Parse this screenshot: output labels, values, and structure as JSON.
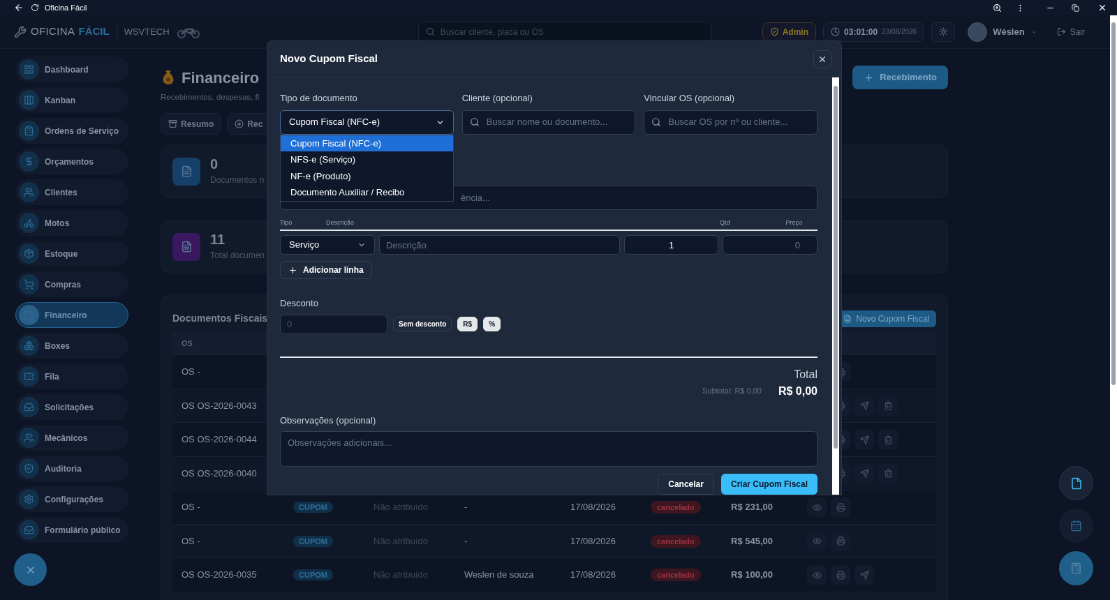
{
  "browser": {
    "title": "Oficina Fácil"
  },
  "header": {
    "brand": "OFICINA",
    "brand_accent": "FÁCIL",
    "company": "WSVTECH",
    "search": {
      "placeholder": "Buscar cliente, placa ou OS"
    },
    "role": "Admin",
    "time": "03:01:00",
    "date": "23/08/2026",
    "user": "Wéslen",
    "logout": "Sair"
  },
  "sidebar": {
    "items": [
      {
        "label": "Dashboard",
        "selected": false
      },
      {
        "label": "Kanban",
        "selected": false
      },
      {
        "label": "Ordens de Serviço",
        "selected": false
      },
      {
        "label": "Orçamentos",
        "selected": false
      },
      {
        "label": "Clientes",
        "selected": false
      },
      {
        "label": "Motos",
        "selected": false
      },
      {
        "label": "Estoque",
        "selected": false
      },
      {
        "label": "Compras",
        "selected": false
      },
      {
        "label": "Financeiro",
        "selected": true
      },
      {
        "label": "Boxes",
        "selected": false
      },
      {
        "label": "Fila",
        "selected": false
      },
      {
        "label": "Solicitações",
        "selected": false
      },
      {
        "label": "Mecânicos",
        "selected": false
      },
      {
        "label": "Auditoria",
        "selected": false
      },
      {
        "label": "Configurações",
        "selected": false
      },
      {
        "label": "Formulário público",
        "selected": false
      }
    ]
  },
  "page": {
    "title": "Financeiro",
    "subtitle": "Recebimentos, despesas, fl",
    "primary_button": "Recebimento",
    "tabs": [
      {
        "label": "Resumo"
      },
      {
        "label": "Rec"
      }
    ],
    "stats": [
      {
        "value": "0",
        "label": "Documentos n",
        "color": "#15406a"
      },
      {
        "value": "11",
        "label": "Total documen",
        "color": "#3a1860"
      }
    ],
    "fiscal": {
      "title": "Documentos Fiscais",
      "button": "Novo Cupom Fiscal",
      "columns": [
        "OS"
      ],
      "rows": [
        {
          "os": "OS -",
          "sendable": false,
          "deletable": false
        },
        {
          "os": "OS OS-2026-0043",
          "sendable": true,
          "deletable": true
        },
        {
          "os": "OS OS-2026-0044",
          "sendable": true,
          "deletable": true
        },
        {
          "os": "OS OS-2026-0040",
          "sendable": true,
          "deletable": true
        },
        {
          "os": "OS -",
          "type": "CUPOM",
          "number": "Não atribuído",
          "client": "-",
          "date": "17/08/2026",
          "status": "cancelado",
          "value": "R$ 231,00",
          "sendable": false,
          "deletable": false
        },
        {
          "os": "OS -",
          "type": "CUPOM",
          "number": "Não atribuído",
          "client": "-",
          "date": "17/08/2026",
          "status": "cancelado",
          "value": "R$ 545,00",
          "sendable": false,
          "deletable": false
        },
        {
          "os": "OS OS-2026-0035",
          "type": "CUPOM",
          "number": "Não atribuído",
          "client": "Weslen de souza",
          "date": "17/08/2026",
          "status": "cancelado",
          "value": "R$ 100,00",
          "sendable": true,
          "deletable": false
        }
      ]
    }
  },
  "modal": {
    "title": "Novo Cupom Fiscal",
    "fields": [
      {
        "kind": "select",
        "label": "Tipo de documento",
        "value": "Cupom Fiscal (NFC-e)",
        "expanded": true,
        "options": [
          {
            "label": "Cupom Fiscal (NFC-e)",
            "selected": true
          },
          {
            "label": "NFS-e (Serviço)",
            "selected": false
          },
          {
            "label": "NF-e (Produto)",
            "selected": false
          },
          {
            "label": "Documento Auxiliar / Recibo",
            "selected": false
          }
        ]
      },
      {
        "kind": "search",
        "label": "Cliente (opcional)",
        "placeholder": "Buscar nome ou documento..."
      },
      {
        "kind": "search",
        "label": "Vincular OS (opcional)",
        "placeholder": "Buscar OS por nº ou cliente..."
      }
    ],
    "reference_field": {
      "placeholder": "ência..."
    },
    "items": {
      "columns": [
        "Tipo",
        "Descrição",
        "Qtd",
        "Preço"
      ],
      "rows": [
        {
          "type": "Serviço",
          "description_placeholder": "Descrição",
          "qty": "1",
          "price_placeholder": "0"
        }
      ],
      "add_button": "Adicionar linha"
    },
    "discount": {
      "label": "Desconto",
      "placeholder": "0",
      "buttons": [
        {
          "label": "Sem desconto",
          "selected": false
        },
        {
          "label": "R$",
          "selected": true
        },
        {
          "label": "%",
          "selected": true
        }
      ]
    },
    "total": {
      "label": "Total",
      "subtotal": "Subtotal: R$ 0,00",
      "value": "R$ 0,00"
    },
    "notes": {
      "label": "Observações (opcional)",
      "placeholder": "Observações adicionais..."
    },
    "buttons": [
      {
        "label": "Cancelar",
        "kind": "secondary"
      },
      {
        "label": "Criar Cupom Fiscal",
        "kind": "primary"
      }
    ]
  }
}
